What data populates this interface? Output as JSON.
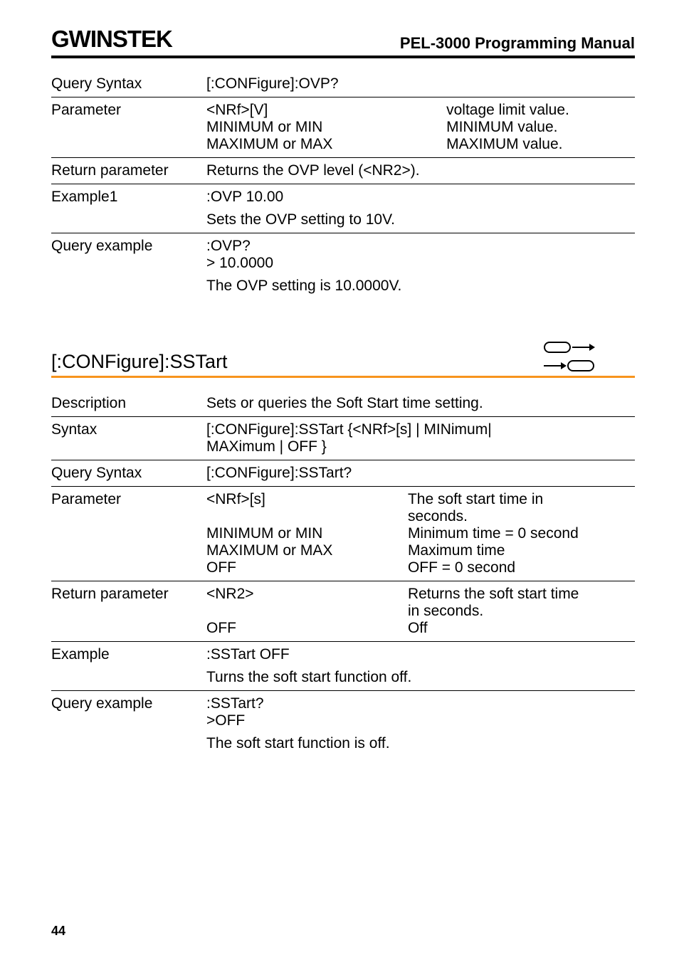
{
  "header": {
    "logo": "GWINSTEK",
    "title": "PEL-3000 Programming Manual"
  },
  "ovp": {
    "querySyntax": {
      "label": "Query Syntax",
      "value": "[:CONFigure]:OVP?"
    },
    "parameter": {
      "label": "Parameter",
      "rows": [
        {
          "left": "<NRf>[V]",
          "right": "voltage limit value."
        },
        {
          "left": "MINIMUM or MIN",
          "right": "MINIMUM value."
        },
        {
          "left": "MAXIMUM or MAX",
          "right": "MAXIMUM value."
        }
      ]
    },
    "returnParam": {
      "label": "Return parameter",
      "value": "Returns the OVP level (<NR2>)."
    },
    "example1": {
      "label": "Example1",
      "value": ":OVP 10.00",
      "note": "Sets the OVP setting to 10V."
    },
    "queryExample": {
      "label": "Query example",
      "l1": ":OVP?",
      "l2": "> 10.0000",
      "note": "The OVP setting is 10.0000V."
    }
  },
  "sstart": {
    "title": "[:CONFigure]:SSTart",
    "description": {
      "label": "Description",
      "value": "Sets or queries the Soft Start time setting."
    },
    "syntax": {
      "label": "Syntax",
      "l1": "[:CONFigure]:SSTart {<NRf>[s] | MINimum|",
      "l2": "MAXimum | OFF }"
    },
    "querySyntax": {
      "label": "Query Syntax",
      "value": "[:CONFigure]:SSTart?"
    },
    "parameter": {
      "label": "Parameter",
      "rows": [
        {
          "left": "<NRf>[s]",
          "r1": "The soft start time in",
          "r2": "seconds."
        },
        {
          "left": "MINIMUM or MIN",
          "right": "Minimum time = 0 second"
        },
        {
          "left": "MAXIMUM or MAX",
          "right": "Maximum time"
        },
        {
          "left": "OFF",
          "right": "OFF = 0 second"
        }
      ]
    },
    "returnParam": {
      "label": "Return parameter",
      "rows": [
        {
          "left": "<NR2>",
          "r1": "Returns the soft start time",
          "r2": "in seconds."
        },
        {
          "left": "OFF",
          "right": "Off"
        }
      ]
    },
    "example": {
      "label": "Example",
      "value": ":SSTart OFF",
      "note": "Turns the soft start function off."
    },
    "queryExample": {
      "label": "Query example",
      "l1": ":SSTart?",
      "l2": ">OFF",
      "note": "The soft start function is off."
    }
  },
  "page": "44"
}
